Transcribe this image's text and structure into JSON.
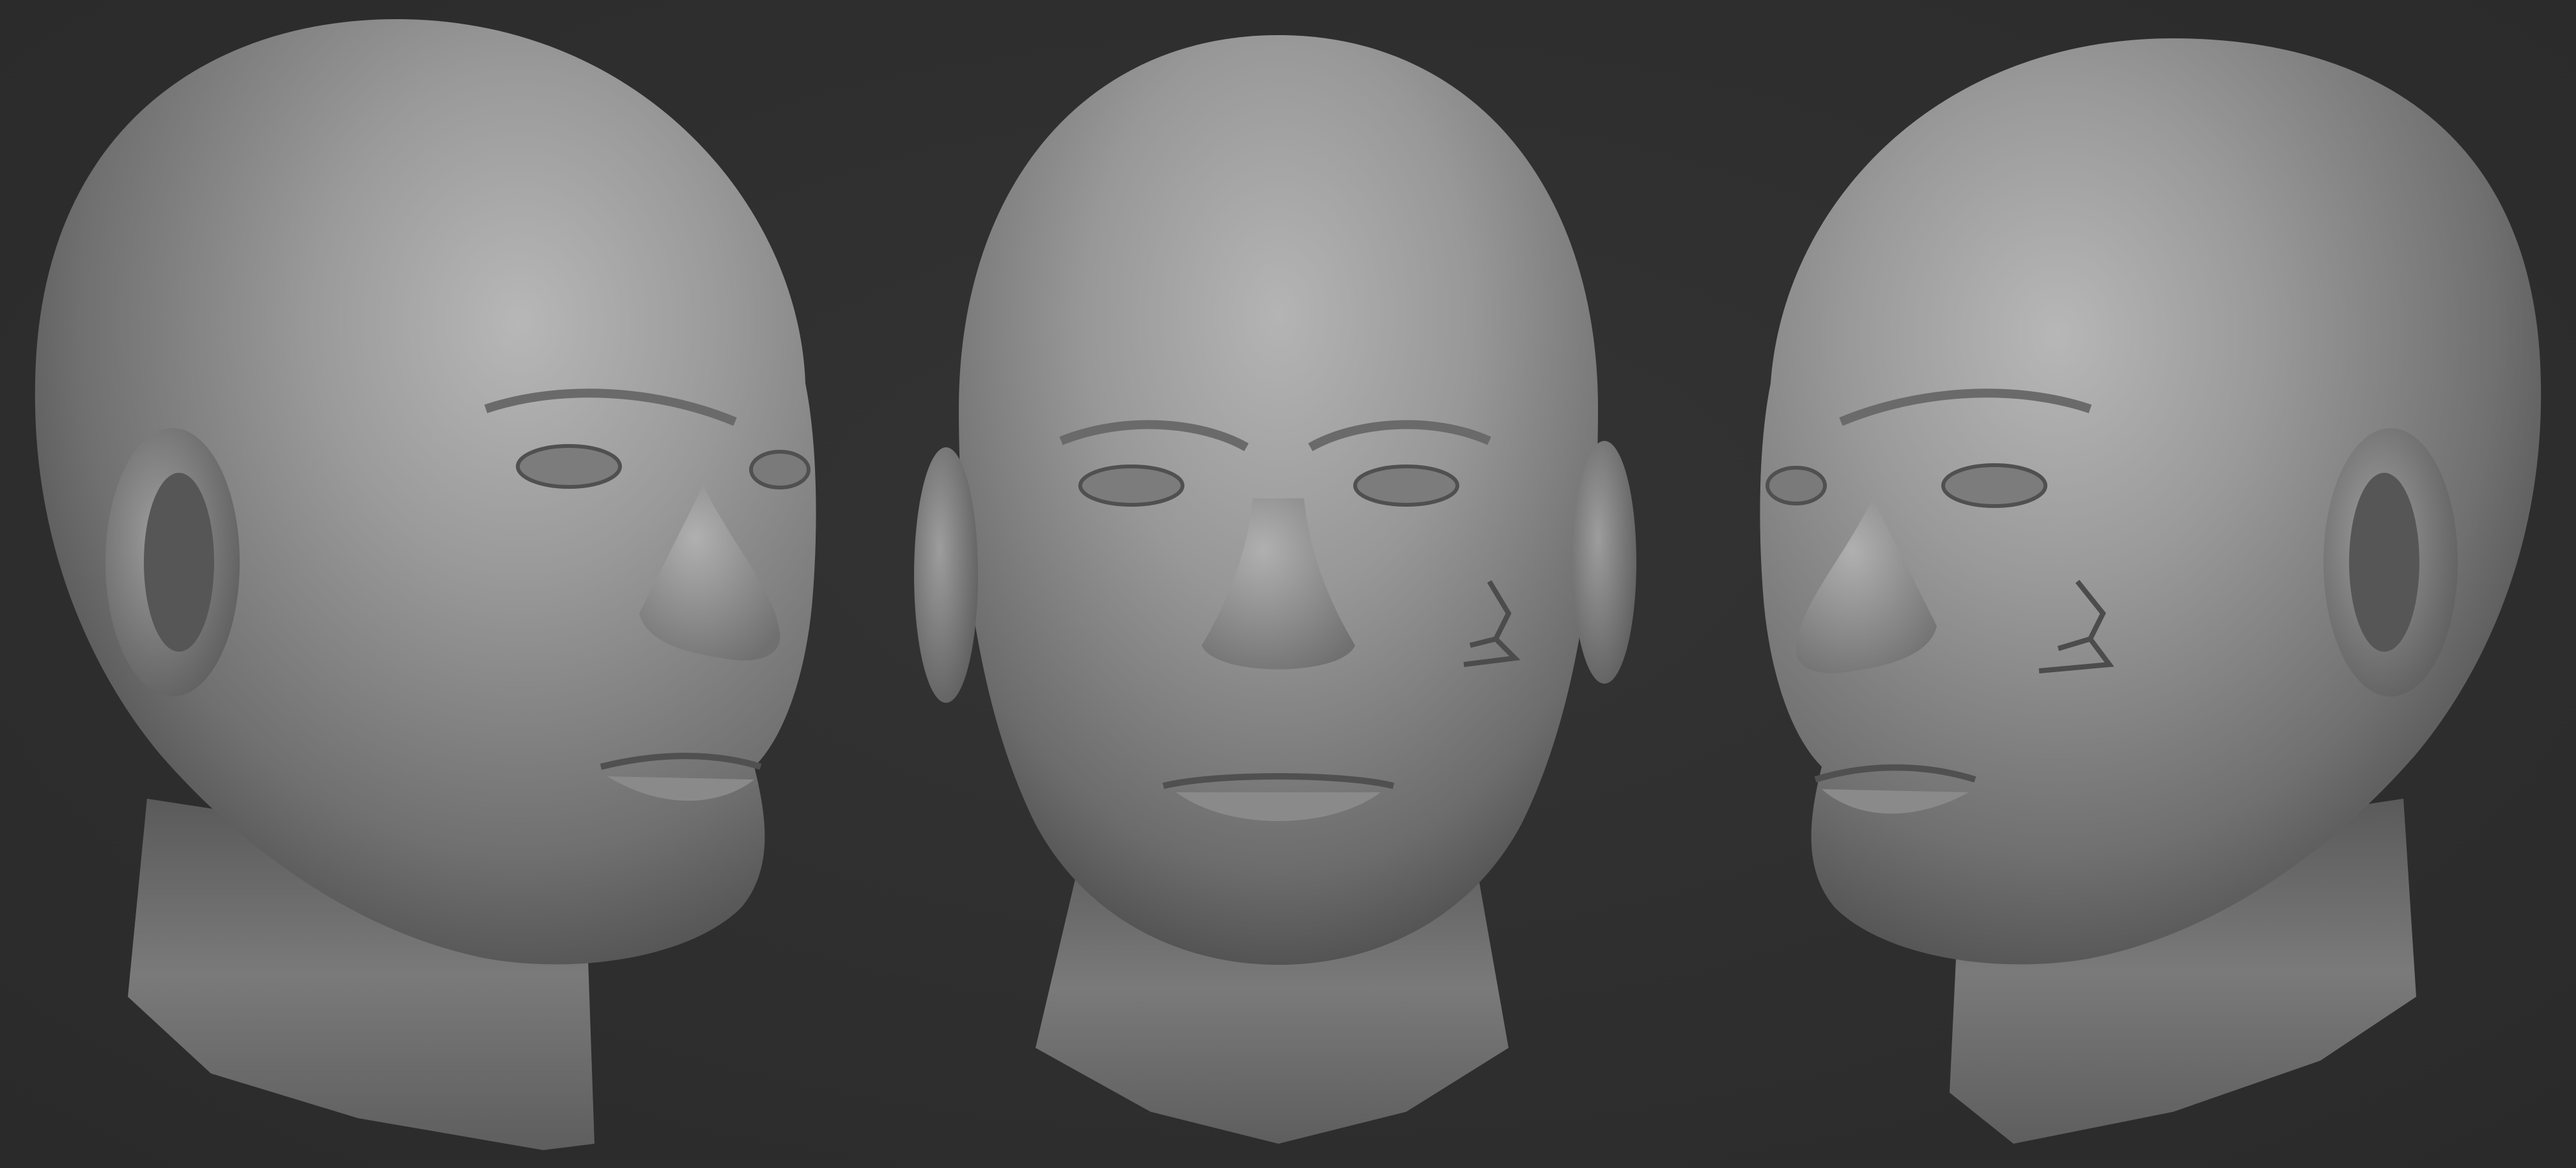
{
  "scene": {
    "background_color": "#2f2f2f",
    "clay_color": "#8f8f8f",
    "views": [
      {
        "name": "three-quarter-left"
      },
      {
        "name": "front"
      },
      {
        "name": "three-quarter-right"
      }
    ]
  }
}
